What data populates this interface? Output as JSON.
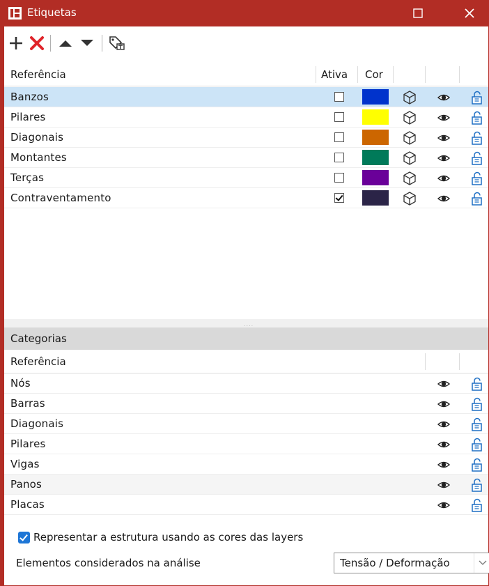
{
  "window": {
    "title": "Etiquetas",
    "maximize_label": "☐",
    "close_label": "✕",
    "accent_color": "#b22d25"
  },
  "toolbar": {
    "items": [
      {
        "icon": "plus-icon"
      },
      {
        "icon": "delete-x-icon"
      },
      {
        "icon": "move-up-icon"
      },
      {
        "icon": "move-down-icon"
      },
      {
        "icon": "tag-settings-icon"
      }
    ]
  },
  "labels_grid": {
    "columns": [
      "Referência",
      "Ativa",
      "Cor"
    ],
    "rows": [
      {
        "name": "Banzos",
        "active": false,
        "color": "#0033cc",
        "selected": true
      },
      {
        "name": "Pilares",
        "active": false,
        "color": "#ffff00",
        "selected": false
      },
      {
        "name": "Diagonais",
        "active": false,
        "color": "#cc6600",
        "selected": false
      },
      {
        "name": "Montantes",
        "active": false,
        "color": "#007a59",
        "selected": false
      },
      {
        "name": "Terças",
        "active": false,
        "color": "#6a0099",
        "selected": false
      },
      {
        "name": "Contraventamento",
        "active": true,
        "color": "#2b2447",
        "selected": false
      }
    ],
    "row_icons": [
      "3d-box-icon",
      "eye-icon",
      "unlock-icon"
    ]
  },
  "categories": {
    "title": "Categorias",
    "columns": [
      "Referência"
    ],
    "rows": [
      {
        "name": "Nós"
      },
      {
        "name": "Barras"
      },
      {
        "name": "Diagonais"
      },
      {
        "name": "Pilares"
      },
      {
        "name": "Vigas"
      },
      {
        "name": "Panos"
      },
      {
        "name": "Placas"
      }
    ],
    "row_icons": [
      "eye-icon",
      "unlock-icon"
    ]
  },
  "options": {
    "use_layer_colors_label": "Representar a estrutura usando as cores das layers",
    "use_layer_colors_checked": true,
    "analysis_label": "Elementos considerados na análise",
    "analysis_value": "Tensão / Deformação"
  }
}
